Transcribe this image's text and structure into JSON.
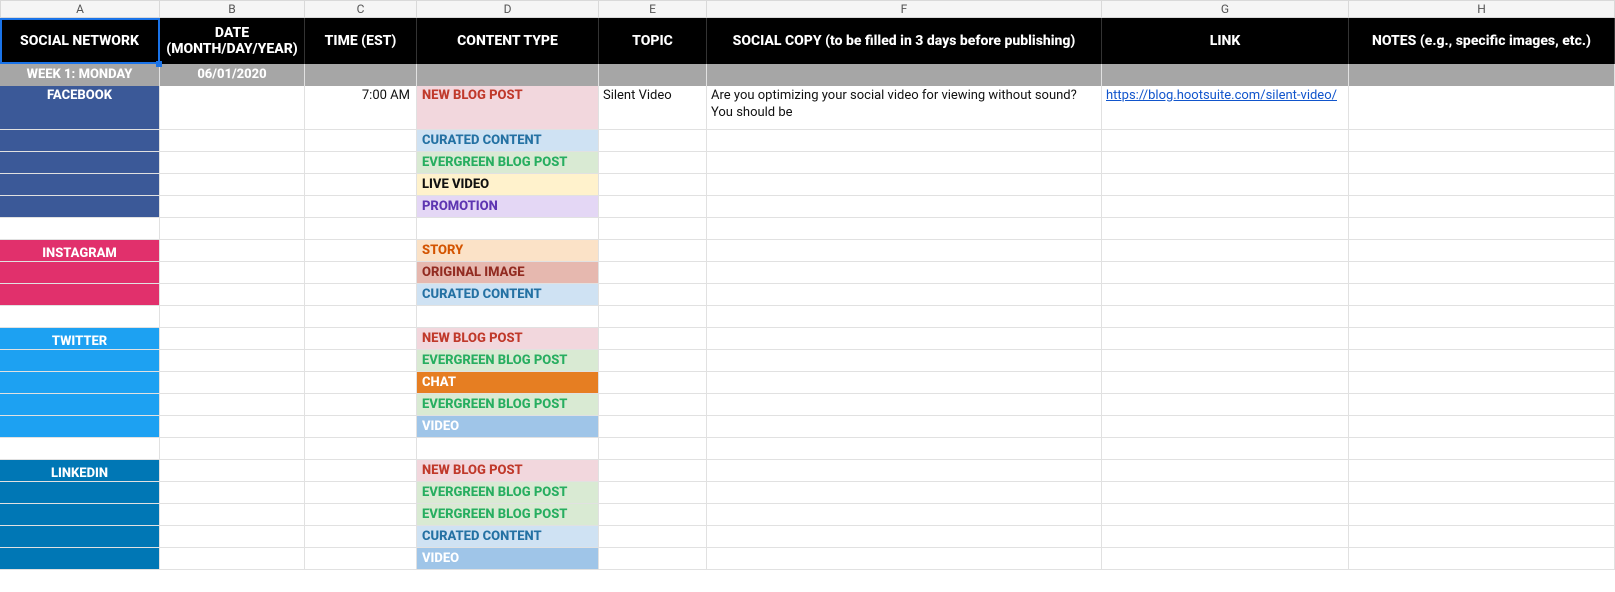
{
  "columns": [
    "A",
    "B",
    "C",
    "D",
    "E",
    "F",
    "G",
    "H"
  ],
  "headers": {
    "A": "SOCIAL NETWORK",
    "B": "DATE\n(MONTH/DAY/YEAR)",
    "C": "TIME (EST)",
    "D": "CONTENT TYPE",
    "E": "TOPIC",
    "F": "SOCIAL COPY (to be filled in 3 days before publishing)",
    "G": "LINK",
    "H": "NOTES (e.g., specific images, etc.)"
  },
  "selected_header": "A",
  "week_row": {
    "label": "WEEK 1: MONDAY",
    "date": "06/01/2020"
  },
  "networks": {
    "facebook": "FACEBOOK",
    "instagram": "INSTAGRAM",
    "twitter": "TWITTER",
    "linkedin": "LINKEDIN"
  },
  "rows": [
    {
      "nw": "facebook",
      "nw_label": true,
      "tall": true,
      "time": "7:00 AM",
      "ct": "NEW BLOG POST",
      "ct_cls": "ct-newblog",
      "topic": "Silent Video",
      "copy": "Are you optimizing your social video for viewing without sound? You should be",
      "link": "https://blog.hootsuite.com/silent-video/"
    },
    {
      "nw": "facebook",
      "ct": "CURATED CONTENT",
      "ct_cls": "ct-curated"
    },
    {
      "nw": "facebook",
      "ct": "EVERGREEN BLOG POST",
      "ct_cls": "ct-evergreen"
    },
    {
      "nw": "facebook",
      "ct": "LIVE VIDEO",
      "ct_cls": "ct-live"
    },
    {
      "nw": "facebook",
      "ct": "PROMOTION",
      "ct_cls": "ct-promo"
    },
    {
      "blank": true
    },
    {
      "nw": "instagram",
      "nw_label": true,
      "ct": "STORY",
      "ct_cls": "ct-story"
    },
    {
      "nw": "instagram",
      "ct": "ORIGINAL IMAGE",
      "ct_cls": "ct-origimg"
    },
    {
      "nw": "instagram",
      "ct": "CURATED CONTENT",
      "ct_cls": "ct-curated"
    },
    {
      "blank": true
    },
    {
      "nw": "twitter",
      "nw_label": true,
      "ct": "NEW BLOG POST",
      "ct_cls": "ct-newblog"
    },
    {
      "nw": "twitter",
      "ct": "EVERGREEN BLOG POST",
      "ct_cls": "ct-evergreen"
    },
    {
      "nw": "twitter",
      "ct": "CHAT",
      "ct_cls": "ct-chat"
    },
    {
      "nw": "twitter",
      "ct": "EVERGREEN BLOG POST",
      "ct_cls": "ct-evergreen"
    },
    {
      "nw": "twitter",
      "ct": "VIDEO",
      "ct_cls": "ct-video"
    },
    {
      "blank": true
    },
    {
      "nw": "linkedin",
      "nw_label": true,
      "ct": "NEW BLOG POST",
      "ct_cls": "ct-newblog"
    },
    {
      "nw": "linkedin",
      "ct": "EVERGREEN BLOG POST",
      "ct_cls": "ct-evergreen"
    },
    {
      "nw": "linkedin",
      "ct": "EVERGREEN BLOG POST",
      "ct_cls": "ct-evergreen"
    },
    {
      "nw": "linkedin",
      "ct": "CURATED CONTENT",
      "ct_cls": "ct-curated"
    },
    {
      "nw": "linkedin",
      "ct": "VIDEO",
      "ct_cls": "ct-video"
    }
  ]
}
